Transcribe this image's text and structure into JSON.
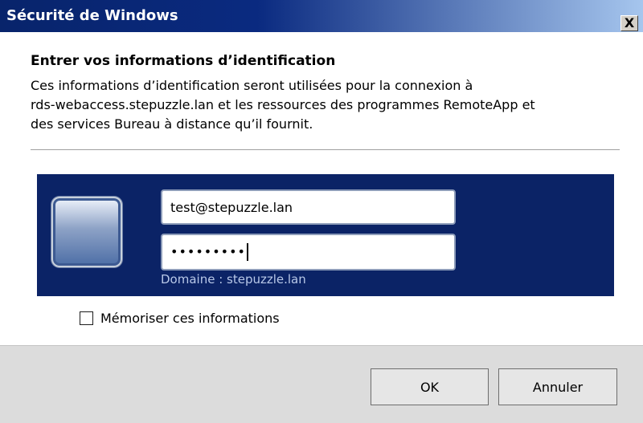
{
  "window": {
    "title": "Sécurité de Windows",
    "close_label": "X",
    "icons": {
      "close": "close-icon"
    }
  },
  "prompt": {
    "heading": "Entrer vos informations d’identification",
    "description_lines": [
      "Ces informations d’identification seront utilisées pour la connexion à",
      "rds-webaccess.stepuzzle.lan et les ressources des programmes RemoteApp et",
      "des services Bureau à distance qu’il fournit."
    ]
  },
  "credentials": {
    "username_value": "test@stepuzzle.lan",
    "password_masked": "•••••••••",
    "domain_label": "Domaine : stepuzzle.lan",
    "avatar_icon": "user-tile-icon"
  },
  "remember": {
    "label": "Mémoriser ces informations",
    "checked": false
  },
  "buttons": {
    "ok_label": "OK",
    "cancel_label": "Annuler"
  },
  "colors": {
    "titlebar_start": "#08246b",
    "titlebar_end": "#a6c6ee",
    "credential_tile_bg": "#0b2366",
    "domain_text": "#b8c8e8",
    "footer_bg": "#dcdcdc"
  }
}
